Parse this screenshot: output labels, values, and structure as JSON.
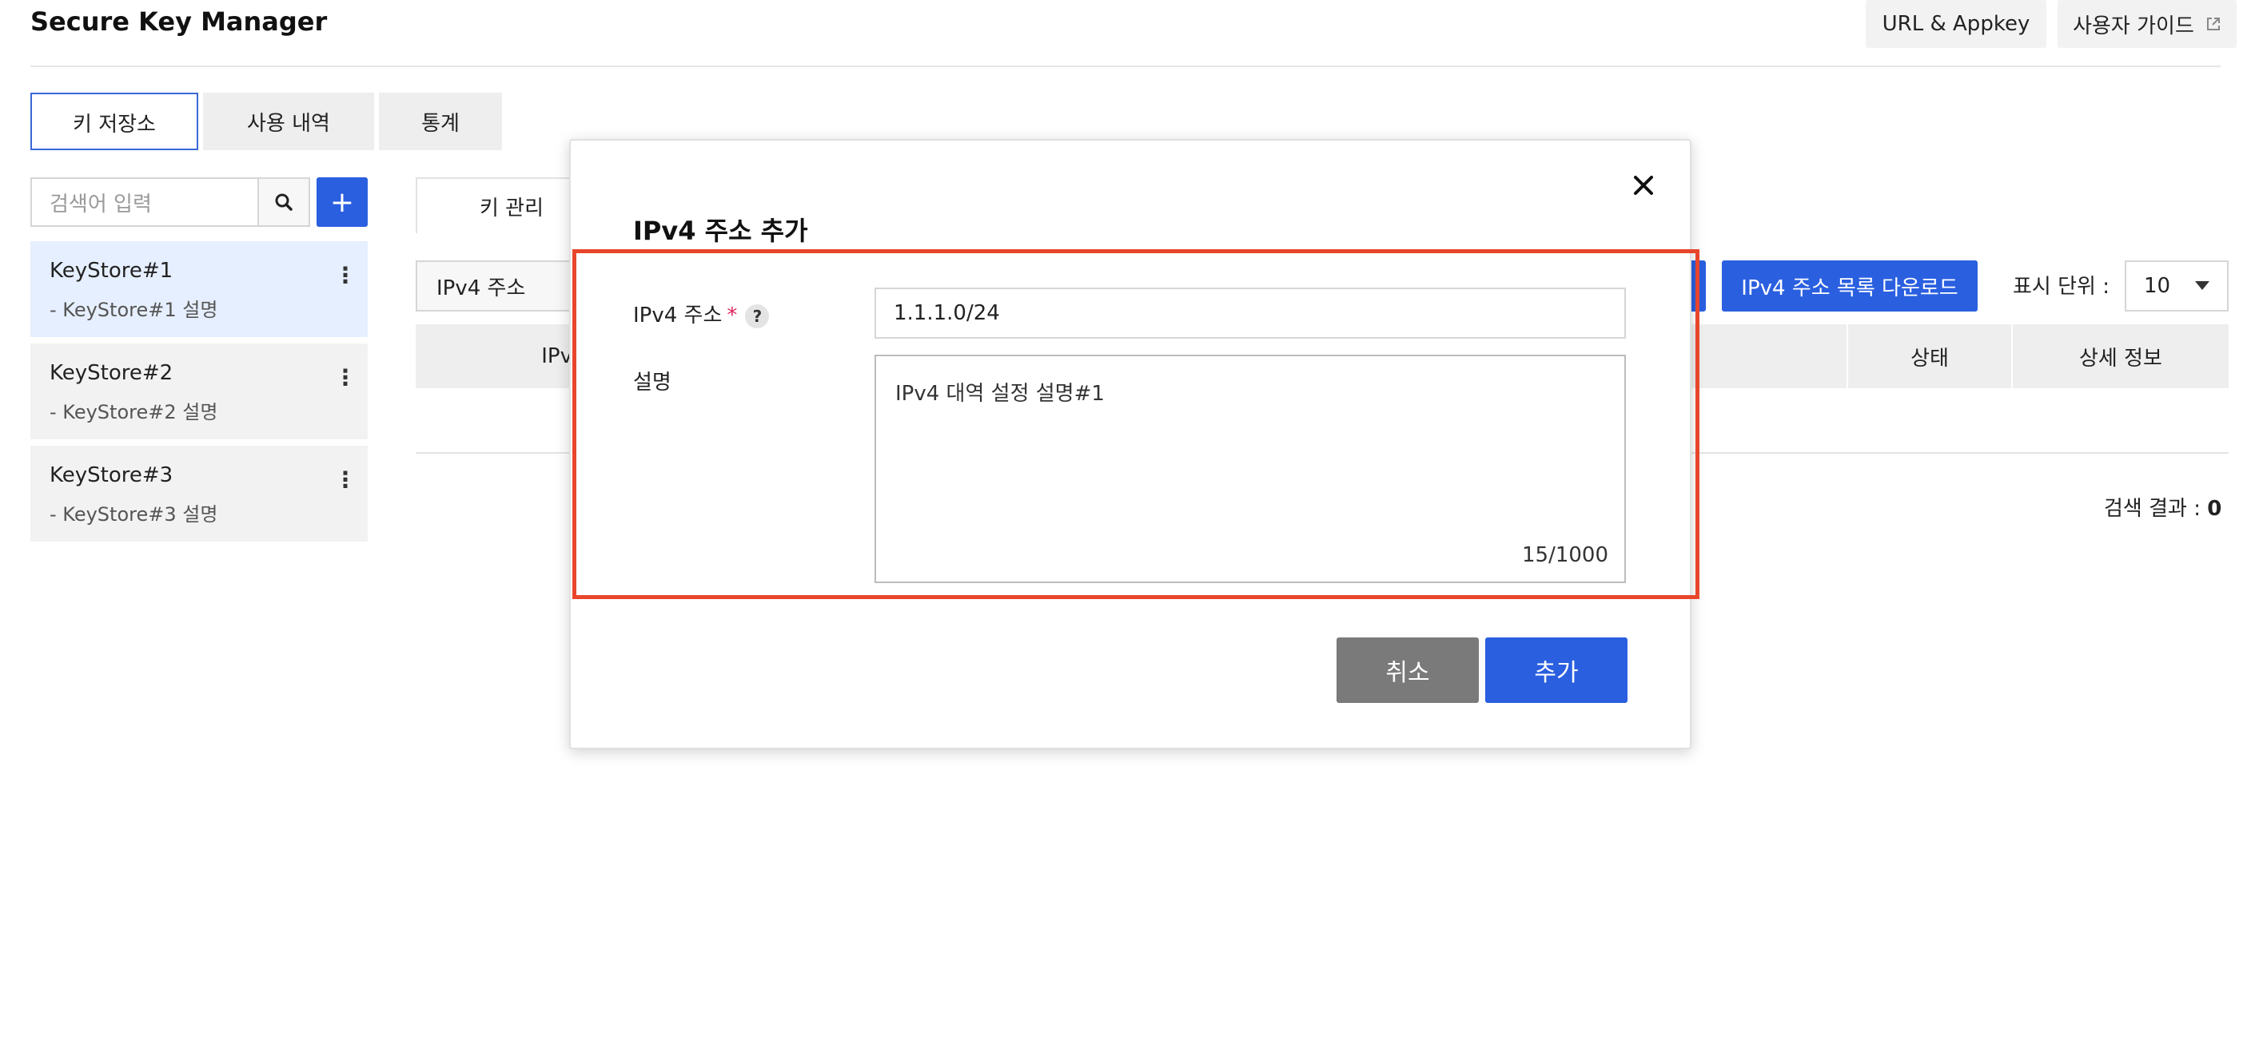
{
  "header": {
    "title": "Secure Key Manager",
    "url_appkey": "URL & Appkey",
    "user_guide": "사용자 가이드"
  },
  "tabs": [
    {
      "label": "키 저장소",
      "active": true
    },
    {
      "label": "사용 내역",
      "active": false
    },
    {
      "label": "통계",
      "active": false
    }
  ],
  "sidebar": {
    "search_placeholder": "검색어 입력",
    "add_label": "+",
    "items": [
      {
        "name": "KeyStore#1",
        "desc": "- KeyStore#1 설명",
        "selected": true
      },
      {
        "name": "KeyStore#2",
        "desc": "- KeyStore#2 설명",
        "selected": false
      },
      {
        "name": "KeyStore#3",
        "desc": "- KeyStore#3 설명",
        "selected": false
      }
    ]
  },
  "main": {
    "sub_tab": "키 관리",
    "filter_select": "IPv4 주소",
    "download_button": "IPv4 주소 목록 다운로드",
    "unit_label": "표시 단위 :",
    "unit_value": "10",
    "columns": {
      "ip_partial": "IPv",
      "status": "상태",
      "detail": "상세 정보"
    },
    "result_label": "검색 결과 :",
    "result_count": "0"
  },
  "modal": {
    "title": "IPv4 주소 추가",
    "ip_label": "IPv4 주소",
    "required_mark": "*",
    "help": "?",
    "ip_value": "1.1.1.0/24",
    "desc_label": "설명",
    "desc_value": "IPv4 대역 설정 설명#1",
    "counter": "15/1000",
    "cancel": "취소",
    "add": "추가"
  },
  "colors": {
    "accent": "#2a5fe0",
    "highlight": "#e8462c",
    "cancel_button": "#7a7a7a"
  }
}
